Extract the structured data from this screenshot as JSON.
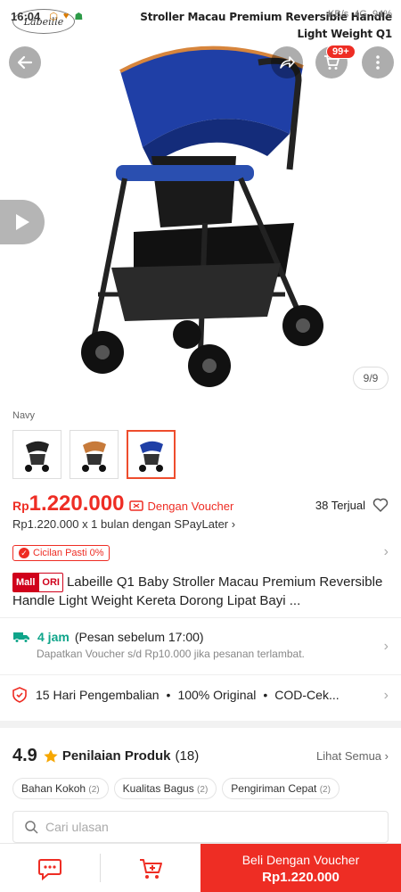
{
  "status_bar": {
    "time": "16:04",
    "network_speed": "KB/s",
    "signal": "4G",
    "battery": "94%"
  },
  "overlay": {
    "logo_text": "Labeille",
    "title": "Stroller Macau Premium Reversible Handle Light Weight Q1"
  },
  "gallery": {
    "counter": "9/9",
    "cart_badge": "99+"
  },
  "variation": {
    "label": "Navy"
  },
  "price": {
    "currency": "Rp",
    "value": "1.220.000",
    "voucher_label": "Dengan Voucher",
    "sold": "38 Terjual",
    "paylater": "Rp1.220.000 x 1 bulan dengan SPayLater"
  },
  "promo": {
    "cicilan": "Cicilan Pasti 0%"
  },
  "product": {
    "mall_label": "Mall",
    "ori_label": "ORI",
    "title": "Labeille Q1 Baby Stroller Macau Premium Reversible Handle Light Weight Kereta Dorong Lipat Bayi ..."
  },
  "shipping": {
    "time": "4 jam",
    "note": "(Pesan sebelum 17:00)",
    "voucher_note": "Dapatkan Voucher s/d Rp10.000 jika pesanan terlambat."
  },
  "guarantee": {
    "return": "15 Hari Pengembalian",
    "original": "100% Original",
    "cod": "COD-Cek..."
  },
  "rating": {
    "value": "4.9",
    "label": "Penilaian Produk",
    "count": "(18)",
    "see_all": "Lihat Semua",
    "chips": [
      {
        "label": "Bahan Kokoh",
        "count": "(2)"
      },
      {
        "label": "Kualitas Bagus",
        "count": "(2)"
      },
      {
        "label": "Pengiriman Cepat",
        "count": "(2)"
      }
    ],
    "search_placeholder": "Cari ulasan"
  },
  "bottom_bar": {
    "buy_label": "Beli Dengan Voucher",
    "buy_price": "Rp1.220.000"
  },
  "colors": {
    "accent": "#ee2d24",
    "teal": "#0fa58a",
    "canopy": "#1f3fa6",
    "trim": "#d7853c"
  }
}
